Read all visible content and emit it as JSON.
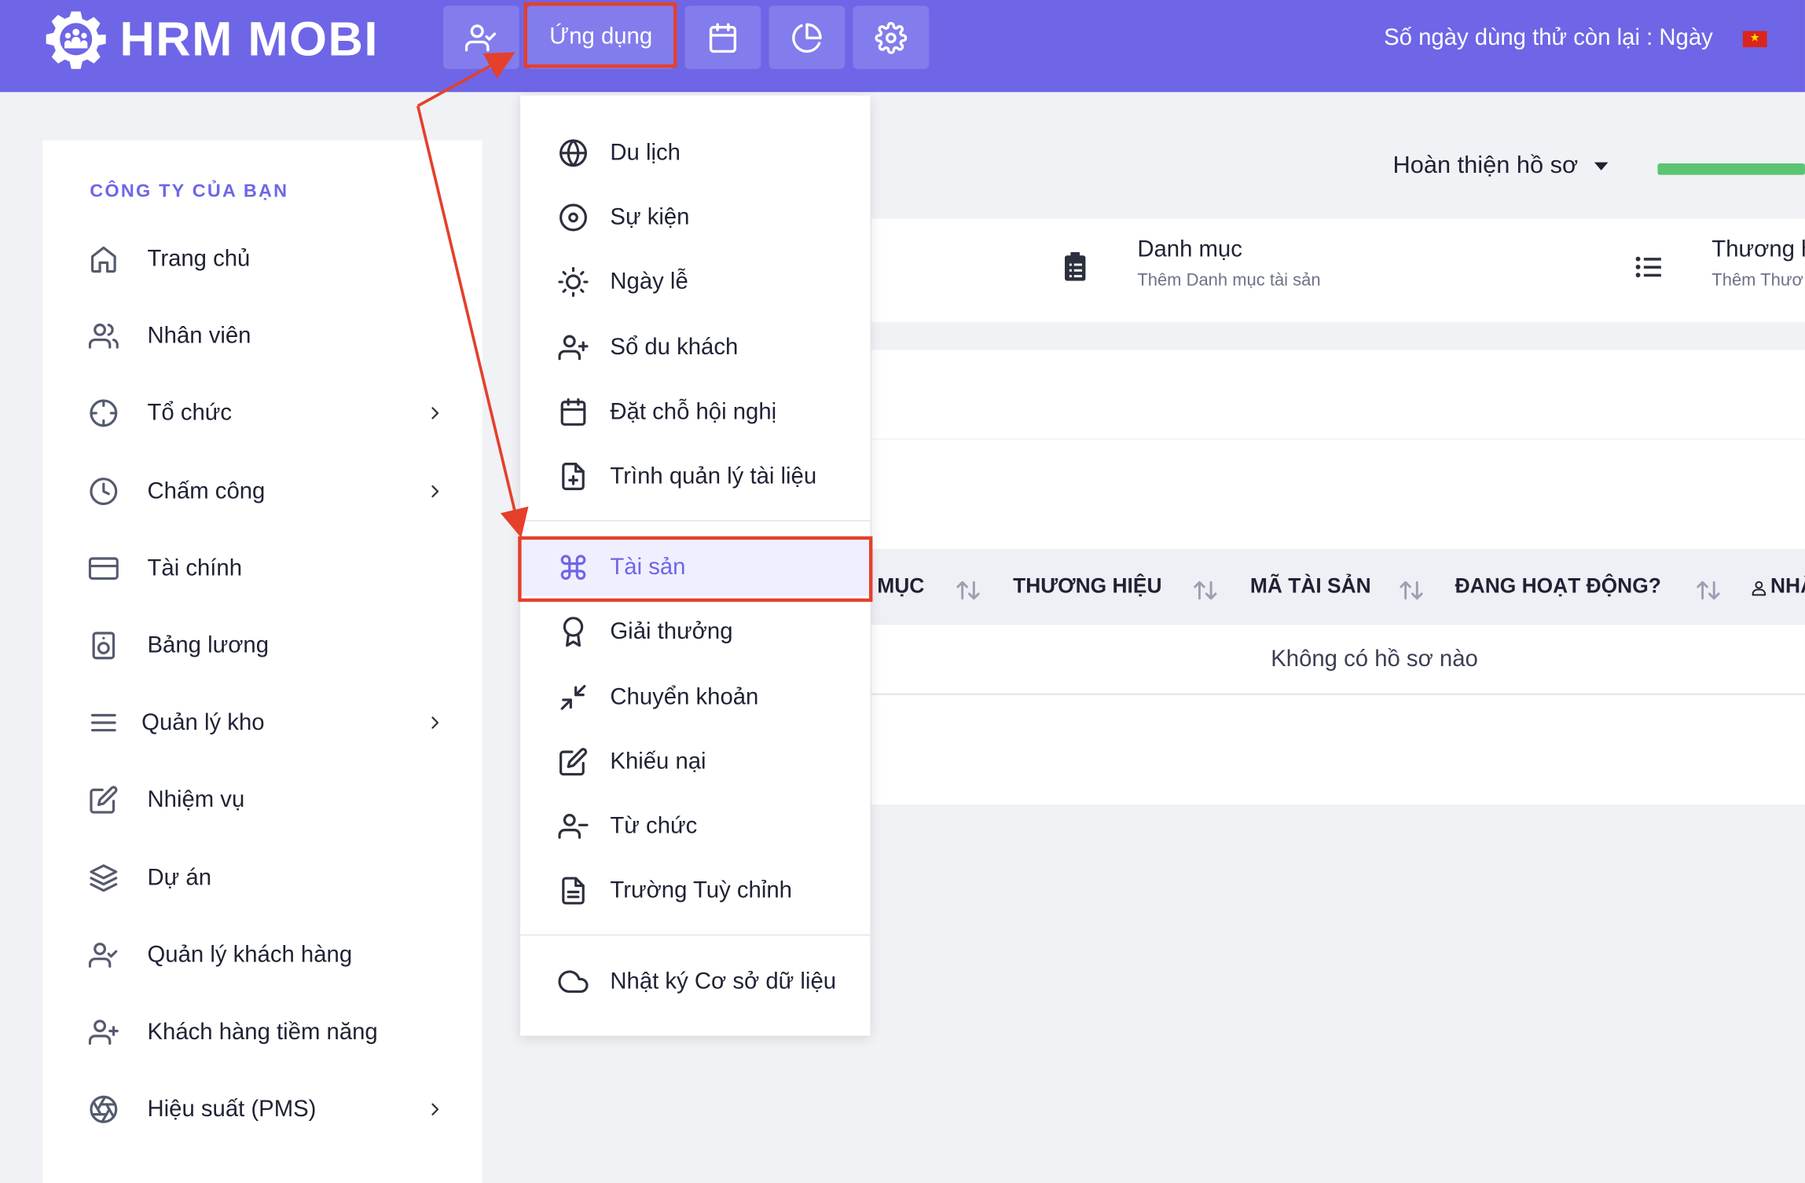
{
  "app": {
    "brand": "HRM MOBI",
    "trial_text": "Số ngày dùng thử còn lại : Ngày"
  },
  "topnav": {
    "apps_label": "Ứng dụng"
  },
  "sidebar": {
    "section_title": "CÔNG TY CỦA BẠN",
    "items": [
      {
        "label": "Trang chủ",
        "icon": "home-icon"
      },
      {
        "label": "Nhân viên",
        "icon": "users-icon"
      },
      {
        "label": "Tổ chức",
        "icon": "crosshair-icon",
        "has_children": true
      },
      {
        "label": "Chấm công",
        "icon": "clock-icon",
        "has_children": true
      },
      {
        "label": "Tài chính",
        "icon": "credit-card-icon"
      },
      {
        "label": "Bảng lương",
        "icon": "speaker-icon"
      },
      {
        "label": "Quản lý kho",
        "icon": "menu-icon",
        "has_children": true
      },
      {
        "label": "Nhiệm vụ",
        "icon": "edit-icon"
      },
      {
        "label": "Dự án",
        "icon": "layers-icon"
      },
      {
        "label": "Quản lý khách hàng",
        "icon": "user-check-icon"
      },
      {
        "label": "Khách hàng tiềm năng",
        "icon": "user-plus-icon"
      },
      {
        "label": "Hiệu suất (PMS)",
        "icon": "aperture-icon",
        "has_children": true
      }
    ]
  },
  "dropdown": {
    "items": [
      {
        "label": "Du lịch",
        "icon": "globe-icon"
      },
      {
        "label": "Sự kiện",
        "icon": "disc-icon"
      },
      {
        "label": "Ngày lễ",
        "icon": "sun-icon"
      },
      {
        "label": "Sổ du khách",
        "icon": "user-plus-icon"
      },
      {
        "label": "Đặt chỗ hội nghị",
        "icon": "calendar-icon"
      },
      {
        "label": "Trình quản lý tài liệu",
        "icon": "file-plus-icon"
      },
      {
        "label": "Tài sản",
        "icon": "command-icon",
        "active": true
      },
      {
        "label": "Giải thưởng",
        "icon": "award-icon"
      },
      {
        "label": "Chuyển khoản",
        "icon": "minimize-icon"
      },
      {
        "label": "Khiếu nại",
        "icon": "edit-icon"
      },
      {
        "label": "Từ chức",
        "icon": "user-minus-icon"
      },
      {
        "label": "Trường Tuỳ chỉnh",
        "icon": "file-text-icon"
      },
      {
        "label": "Nhật ký Cơ sở dữ liệu",
        "icon": "cloud-icon"
      }
    ]
  },
  "main": {
    "profile_label": "Hoàn thiện hồ sơ",
    "cards": [
      {
        "title": "Danh mục",
        "subtitle": "Thêm Danh mục tài sản"
      },
      {
        "title": "Thương h",
        "subtitle": "Thêm Thươ"
      }
    ],
    "table": {
      "headers": [
        "MỤC",
        "THƯƠNG HIỆU",
        "MÃ TÀI SẢN",
        "ĐANG HOẠT ĐỘNG?",
        "NHÂ"
      ],
      "empty_text": "Không có hồ sơ nào"
    }
  },
  "colors": {
    "accent": "#6e66e6",
    "highlight": "#e4402c",
    "progress": "#5cc473"
  }
}
